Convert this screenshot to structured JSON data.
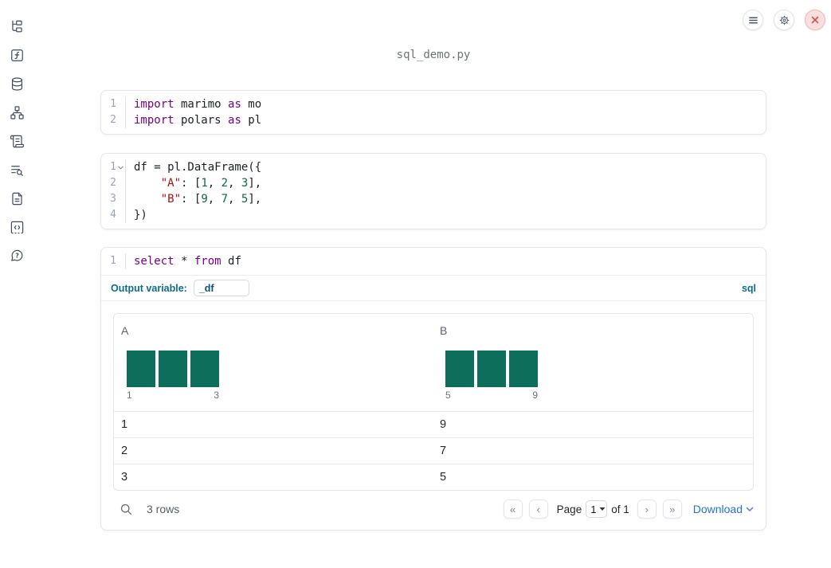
{
  "header": {
    "filename": "sql_demo.py"
  },
  "top_actions": {
    "menu": "notebook-menu",
    "settings": "settings",
    "shutdown": "shutdown"
  },
  "sidebar": {
    "icons": [
      "file-explorer",
      "functions",
      "datasources",
      "dependency-graph",
      "logs",
      "table-of-contents",
      "documentation",
      "scratchpad",
      "help"
    ]
  },
  "colors": {
    "keyword": "#770088",
    "string": "#aa1111",
    "number": "#116644",
    "histogram_bar": "#0e6e5c",
    "sql_accent": "#0e6b8d",
    "link_blue": "#2671d9"
  },
  "cells": [
    {
      "lines": [
        {
          "num": "1",
          "tokens": [
            {
              "t": "import",
              "c": "kw"
            },
            {
              "t": " marimo ",
              "c": "pl"
            },
            {
              "t": "as",
              "c": "kw"
            },
            {
              "t": " mo",
              "c": "pl"
            }
          ]
        },
        {
          "num": "2",
          "tokens": [
            {
              "t": "import",
              "c": "kw"
            },
            {
              "t": " polars ",
              "c": "pl"
            },
            {
              "t": "as",
              "c": "kw"
            },
            {
              "t": " pl",
              "c": "pl"
            }
          ]
        }
      ]
    },
    {
      "lines": [
        {
          "num": "1",
          "fold": true,
          "tokens": [
            {
              "t": "df = pl.DataFrame({",
              "c": "pl"
            }
          ]
        },
        {
          "num": "2",
          "tokens": [
            {
              "t": "    ",
              "c": "pl"
            },
            {
              "t": "\"A\"",
              "c": "str"
            },
            {
              "t": ": [",
              "c": "pl"
            },
            {
              "t": "1",
              "c": "num"
            },
            {
              "t": ", ",
              "c": "pl"
            },
            {
              "t": "2",
              "c": "num"
            },
            {
              "t": ", ",
              "c": "pl"
            },
            {
              "t": "3",
              "c": "num"
            },
            {
              "t": "],",
              "c": "pl"
            }
          ]
        },
        {
          "num": "3",
          "tokens": [
            {
              "t": "    ",
              "c": "pl"
            },
            {
              "t": "\"B\"",
              "c": "str"
            },
            {
              "t": ": [",
              "c": "pl"
            },
            {
              "t": "9",
              "c": "num"
            },
            {
              "t": ", ",
              "c": "pl"
            },
            {
              "t": "7",
              "c": "num"
            },
            {
              "t": ", ",
              "c": "pl"
            },
            {
              "t": "5",
              "c": "num"
            },
            {
              "t": "],",
              "c": "pl"
            }
          ]
        },
        {
          "num": "4",
          "tokens": [
            {
              "t": "})",
              "c": "pl"
            }
          ]
        }
      ]
    },
    {
      "lines": [
        {
          "num": "1",
          "tokens": [
            {
              "t": "select",
              "c": "kw"
            },
            {
              "t": " * ",
              "c": "pl"
            },
            {
              "t": "from",
              "c": "kw"
            },
            {
              "t": " df",
              "c": "pl"
            }
          ]
        }
      ]
    }
  ],
  "sql_cell": {
    "output_variable_label": "Output variable:",
    "output_variable_value": "_df",
    "language_badge": "sql"
  },
  "table": {
    "columns": [
      {
        "name": "A",
        "hist": {
          "values": [
            1,
            1,
            1
          ],
          "min_label": "1",
          "max_label": "3"
        }
      },
      {
        "name": "B",
        "hist": {
          "values": [
            1,
            1,
            1
          ],
          "min_label": "5",
          "max_label": "9"
        }
      }
    ],
    "rows": [
      [
        "1",
        "9"
      ],
      [
        "2",
        "7"
      ],
      [
        "3",
        "5"
      ]
    ],
    "footer": {
      "row_count": "3 rows",
      "page_label": "Page",
      "page_value": "1",
      "of_label": "of 1",
      "download_label": "Download"
    },
    "pagination_icons": {
      "first": "«",
      "prev": "‹",
      "next": "›",
      "last": "»"
    }
  }
}
